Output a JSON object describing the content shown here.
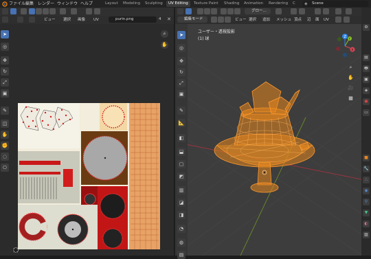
{
  "topbar": {
    "menus": [
      "ファイル",
      "編集",
      "レンダー",
      "ウィンドウ",
      "ヘルプ"
    ],
    "workspaces": [
      "Layout",
      "Modeling",
      "Sculpting",
      "UV Editing",
      "Texture Paint",
      "Shading",
      "Animation",
      "Rendering",
      "C"
    ],
    "active_workspace": "UV Editing",
    "scene_name": "Scene"
  },
  "uv_editor": {
    "menus": [
      "ビュー",
      "選択",
      "画像",
      "UV"
    ],
    "image_name": "purin.png",
    "image_users": "4"
  },
  "viewport": {
    "mode_label": "編集モード",
    "menus": [
      "ビュー",
      "選択",
      "追加",
      "メッシュ",
      "頂点",
      "辺",
      "面",
      "UV"
    ],
    "transform_orientation": "グロー...",
    "view_name": "ユーザー・透視投影",
    "object_label": "(1) 球"
  },
  "gizmo": {
    "x_color": "#e04454",
    "y_color": "#8ac22c",
    "z_color": "#2f86e6"
  },
  "colors": {
    "accent": "#4772b3",
    "mesh_edit": "#ff8c1a",
    "uv_seam": "#ff2020"
  }
}
